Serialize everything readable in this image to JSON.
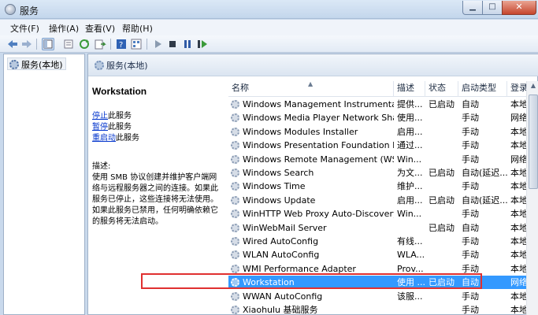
{
  "window": {
    "title": "服务"
  },
  "menu": [
    "文件(F)",
    "操作(A)",
    "查看(V)",
    "帮助(H)"
  ],
  "tree": {
    "root": "服务(本地)"
  },
  "main": {
    "header": "服务(本地)",
    "selected_name": "Workstation",
    "actions": [
      {
        "link": "停止",
        "suffix": "此服务"
      },
      {
        "link": "暂停",
        "suffix": "此服务"
      },
      {
        "link": "重启动",
        "suffix": "此服务"
      }
    ],
    "description_label": "描述:",
    "description_lines": [
      "使用 SMB 协议创建并维护客户端网",
      "络与远程服务器之间的连接。如果此",
      "服务已停止，这些连接将无法使用。",
      "如果此服务已禁用，任何明确依赖它",
      "的服务将无法启动。"
    ]
  },
  "columns": [
    "名称",
    "描述",
    "状态",
    "启动类型",
    "登录"
  ],
  "rows": [
    {
      "name": "Windows Management Instrumentation",
      "desc": "提供...",
      "status": "已启动",
      "startup": "自动",
      "logon": "本地"
    },
    {
      "name": "Windows Media Player Network Shari...",
      "desc": "使用...",
      "status": "",
      "startup": "手动",
      "logon": "网络"
    },
    {
      "name": "Windows Modules Installer",
      "desc": "启用...",
      "status": "",
      "startup": "手动",
      "logon": "本地"
    },
    {
      "name": "Windows Presentation Foundation Fo...",
      "desc": "通过...",
      "status": "",
      "startup": "手动",
      "logon": "本地"
    },
    {
      "name": "Windows Remote Management (WS-...",
      "desc": "Win...",
      "status": "",
      "startup": "手动",
      "logon": "网络"
    },
    {
      "name": "Windows Search",
      "desc": "为文...",
      "status": "已启动",
      "startup": "自动(延迟...",
      "logon": "本地"
    },
    {
      "name": "Windows Time",
      "desc": "维护...",
      "status": "",
      "startup": "手动",
      "logon": "本地"
    },
    {
      "name": "Windows Update",
      "desc": "启用...",
      "status": "已启动",
      "startup": "自动(延迟...",
      "logon": "本地"
    },
    {
      "name": "WinHTTP Web Proxy Auto-Discovery ...",
      "desc": "Win...",
      "status": "",
      "startup": "手动",
      "logon": "本地"
    },
    {
      "name": "WinWebMail Server",
      "desc": "",
      "status": "已启动",
      "startup": "自动",
      "logon": "本地"
    },
    {
      "name": "Wired AutoConfig",
      "desc": "有线...",
      "status": "",
      "startup": "手动",
      "logon": "本地"
    },
    {
      "name": "WLAN AutoConfig",
      "desc": "WLA...",
      "status": "",
      "startup": "手动",
      "logon": "本地"
    },
    {
      "name": "WMI Performance Adapter",
      "desc": "Prov...",
      "status": "",
      "startup": "手动",
      "logon": "本地"
    },
    {
      "name": "Workstation",
      "desc": "使用 ...",
      "status": "已启动",
      "startup": "自动",
      "logon": "网络",
      "selected": true
    },
    {
      "name": "WWAN AutoConfig",
      "desc": "该服...",
      "status": "",
      "startup": "手动",
      "logon": "本地"
    },
    {
      "name": "Xiaohulu 基础服务",
      "desc": "",
      "status": "",
      "startup": "手动",
      "logon": "本地"
    }
  ],
  "colors": {
    "selection": "#3399ff",
    "highlight_border": "#e03030",
    "link": "#0033cc"
  }
}
